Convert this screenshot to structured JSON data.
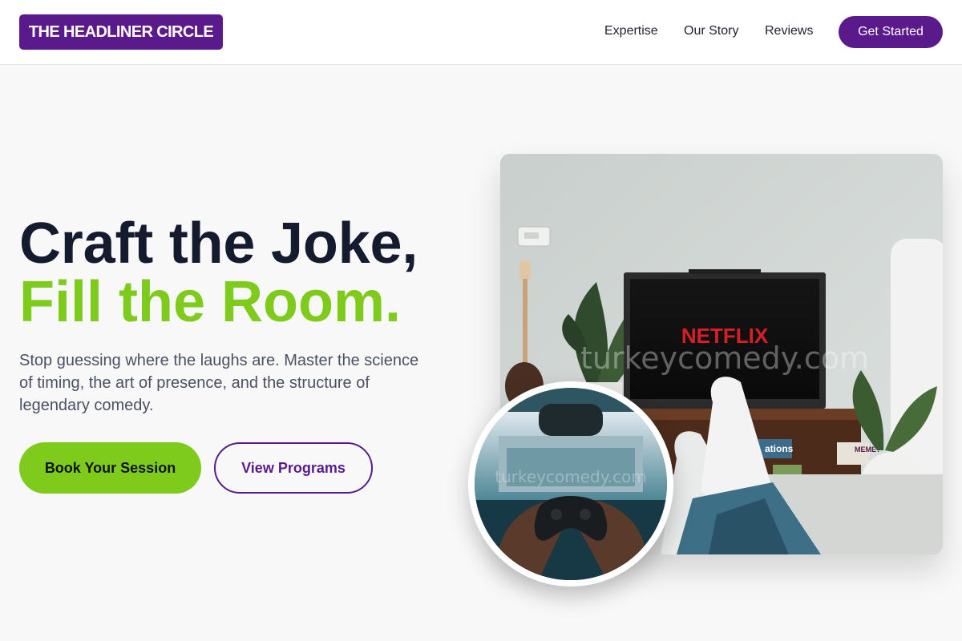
{
  "header": {
    "logo_text": "THE HEADLINER CIRCLE",
    "nav": [
      "Expertise",
      "Our Story",
      "Reviews"
    ],
    "cta_label": "Get Started"
  },
  "hero": {
    "headline_line1": "Craft the Joke,",
    "headline_line2": "Fill the Room.",
    "subtext": "Stop guessing where the laughs are. Master the science of timing, the art of presence, and the structure of legendary comedy.",
    "primary_button": "Book Your Session",
    "secondary_button": "View Programs"
  },
  "photos": {
    "main_alt": "Living room with TV showing Netflix and feet on coffee table",
    "tv_brand": "NETFLIX",
    "watermark": "turkeycomedy.com",
    "book_label_1": "ations",
    "book_label_2": "MEME?",
    "circle_alt": "Hands holding a game controller"
  },
  "colors": {
    "brand_purple": "#5b1a8c",
    "accent_green": "#7ecb1c",
    "headline_dark": "#151b2e",
    "netflix_red": "#d81f26"
  }
}
